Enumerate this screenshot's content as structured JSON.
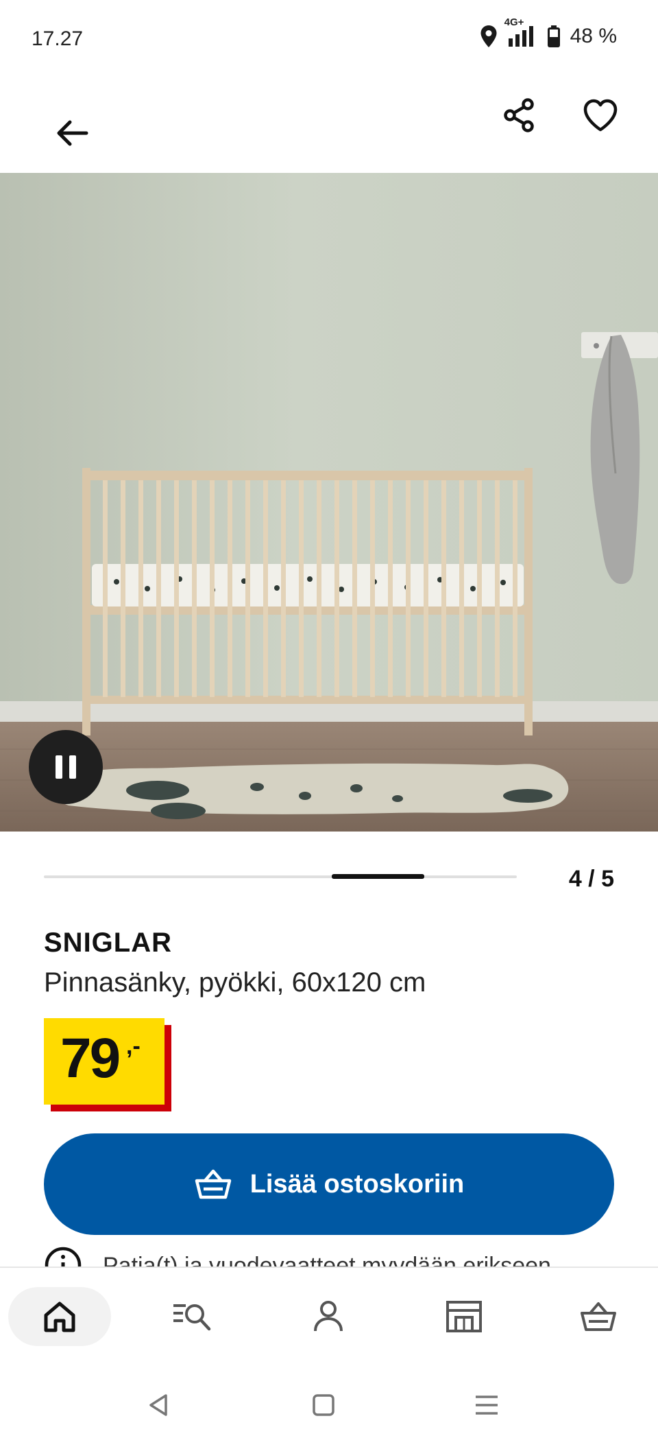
{
  "status_bar": {
    "time": "17.27",
    "network": "4G+",
    "battery": "48 %",
    "icons": [
      "location-icon",
      "signal-icon",
      "battery-icon"
    ]
  },
  "header": {
    "icons": [
      "back-arrow-icon",
      "share-icon",
      "heart-icon"
    ]
  },
  "gallery": {
    "counter": "4 / 5",
    "current": 4,
    "total": 5,
    "autoplay_state": "playing",
    "image_subject": "wooden crib in a nursery"
  },
  "product": {
    "name": "SNIGLAR",
    "description": "Pinnasänky, pyökki, 60x120 cm",
    "price_integer": "79",
    "price_decimal": ",-"
  },
  "cta": {
    "label": "Lisää ostoskoriin",
    "icon": "basket-icon"
  },
  "info": {
    "text": "Patja(t) ja vuodevaatteet myydään erikseen",
    "icon": "info-icon"
  },
  "bottom_nav": {
    "items": [
      {
        "name": "home",
        "icon": "home-icon",
        "active": true
      },
      {
        "name": "search",
        "icon": "search-icon",
        "active": false
      },
      {
        "name": "profile",
        "icon": "profile-icon",
        "active": false
      },
      {
        "name": "store",
        "icon": "store-icon",
        "active": false
      },
      {
        "name": "cart",
        "icon": "cart-icon",
        "active": false
      }
    ]
  },
  "colors": {
    "brand_blue": "#0058a3",
    "price_yellow": "#ffdb00",
    "price_red": "#cc0008"
  }
}
